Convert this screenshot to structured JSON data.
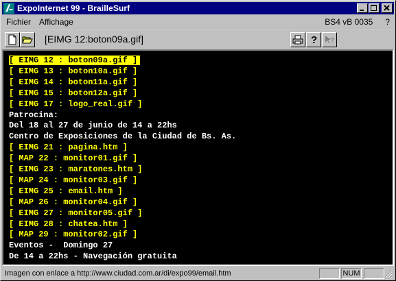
{
  "window": {
    "title": "ExpoInternet 99 - BrailleSurf",
    "buttons": {
      "minimize": "_",
      "maximize": "□",
      "close": "×"
    }
  },
  "menu": {
    "items": [
      "Fichier",
      "Affichage"
    ],
    "version": "BS4 vB 0035",
    "help": "?"
  },
  "toolbar": {
    "document_title": "[EIMG 12:boton09a.gif]",
    "icons": [
      "new-document-icon",
      "open-folder-icon",
      "print-icon",
      "help-icon",
      "context-help-icon"
    ]
  },
  "content": {
    "lines": [
      {
        "text": "[ EIMG 12 : boton09a.gif ]",
        "kind": "link",
        "selected": true
      },
      {
        "text": "[ EIMG 13 : boton10a.gif ]",
        "kind": "link"
      },
      {
        "text": "[ EIMG 14 : boton11a.gif ]",
        "kind": "link"
      },
      {
        "text": "[ EIMG 15 : boton12a.gif ]",
        "kind": "link"
      },
      {
        "text": "[ EIMG 17 : logo_real.gif ]",
        "kind": "link"
      },
      {
        "text": "Patrocina:",
        "kind": "text"
      },
      {
        "text": "Del 18 al 27 de junio de 14 a 22hs",
        "kind": "text"
      },
      {
        "text": "Centro de Exposiciones de la Ciudad de Bs. As.",
        "kind": "text"
      },
      {
        "text": "[ EIMG 21 : pagina.htm ]",
        "kind": "link"
      },
      {
        "text": "[ MAP 22 : monitor01.gif ]",
        "kind": "link"
      },
      {
        "text": "[ EIMG 23 : maratones.htm ]",
        "kind": "link"
      },
      {
        "text": "[ MAP 24 : monitor03.gif ]",
        "kind": "link"
      },
      {
        "text": "[ EIMG 25 : email.htm ]",
        "kind": "link"
      },
      {
        "text": "[ MAP 26 : monitor04.gif ]",
        "kind": "link"
      },
      {
        "text": "[ EIMG 27 : monitor05.gif ]",
        "kind": "link"
      },
      {
        "text": "[ EIMG 28 : chatea.htm ]",
        "kind": "link"
      },
      {
        "text": "[ MAP 29 : monitor02.gif ]",
        "kind": "link"
      },
      {
        "text": "Eventos -  Domingo 27",
        "kind": "text"
      },
      {
        "text": "De 14 a 22hs - Navegación gratuita",
        "kind": "text"
      }
    ]
  },
  "status": {
    "message": "Imagen con enlace a http://www.ciudad.com.ar/di/expo99/email.htm",
    "num": "NUM"
  }
}
